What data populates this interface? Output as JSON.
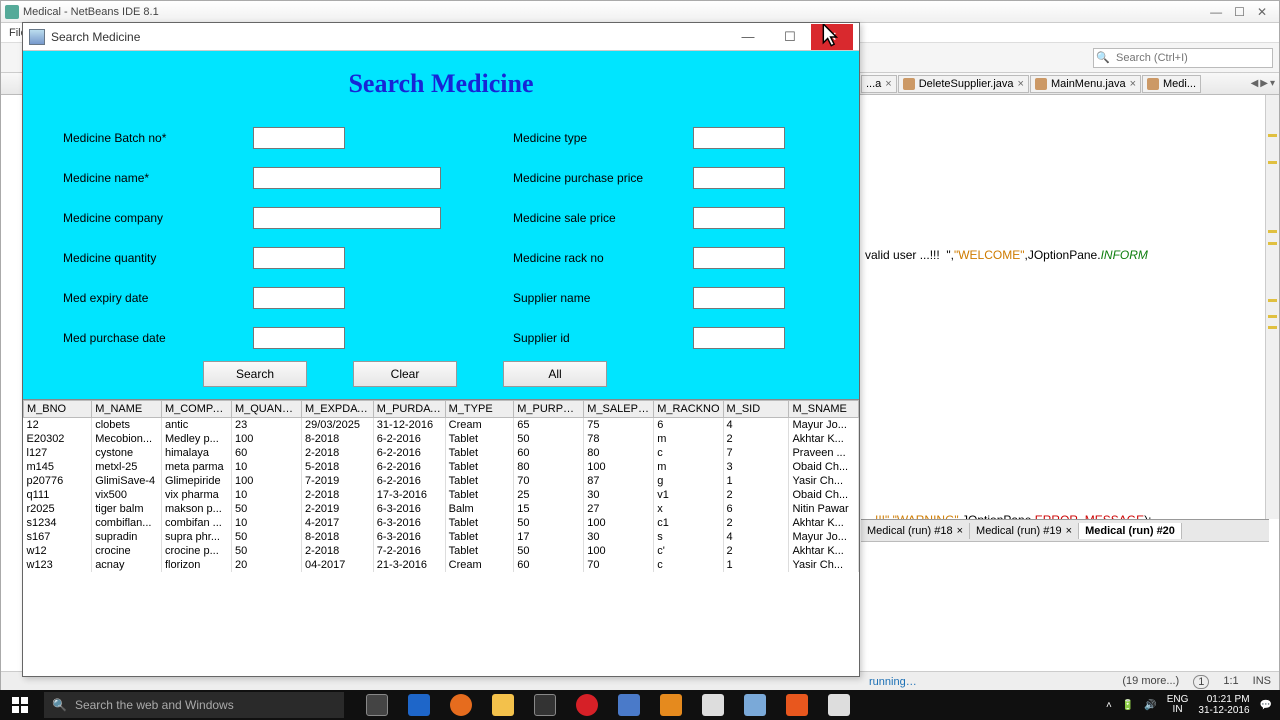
{
  "ide": {
    "title": "Medical - NetBeans IDE 8.1",
    "menu_file": "File",
    "search_placeholder": "Search (Ctrl+I)",
    "tabs": [
      {
        "label": "...a"
      },
      {
        "label": "DeleteSupplier.java"
      },
      {
        "label": "MainMenu.java"
      },
      {
        "label": "Medi..."
      }
    ],
    "code_line1_a": "valid user ...!!!  \",",
    "code_line1_b": "\"WELCOME\"",
    "code_line1_c": ",JOptionPane.",
    "code_line1_d": "INFORM",
    "code_line2_a": "...!!!\",",
    "code_line2_b": "\"WARNING\"",
    "code_line2_c": ",JOptionPane.",
    "code_line2_d": "ERROR_MESSAGE",
    "code_line2_e": ");",
    "out_tabs": [
      {
        "label": "Medical (run) #18"
      },
      {
        "label": "Medical (run) #19"
      },
      {
        "label": "Medical (run) #20"
      }
    ],
    "status_running": "running…",
    "status_more": "(19 more...)",
    "status_badge": "1",
    "status_pos": "1:1",
    "status_ins": "INS"
  },
  "child": {
    "title": "Search Medicine",
    "heading": "Search Medicine",
    "labels": {
      "batch": "Medicine Batch no*",
      "name": "Medicine name*",
      "company": "Medicine company",
      "qty": "Medicine quantity",
      "exp": "Med expiry date",
      "pur": "Med purchase date",
      "type": "Medicine type",
      "pprice": "Medicine purchase price",
      "sprice": "Medicine sale price",
      "rack": "Medicine rack no",
      "sname": "Supplier name",
      "sid": "Supplier id"
    },
    "buttons": {
      "search": "Search",
      "clear": "Clear",
      "all": "All"
    },
    "columns": [
      "M_BNO",
      "M_NAME",
      "M_COMPA...",
      "M_QUANTI...",
      "M_EXPDATE",
      "M_PURDATE",
      "M_TYPE",
      "M_PURPRI...",
      "M_SALEPR...",
      "M_RACKNO",
      "M_SID",
      "M_SNAME"
    ],
    "rows": [
      [
        "12",
        "clobets",
        "antic",
        "23",
        "29/03/2025",
        "31-12-2016",
        "Cream",
        "65",
        "75",
        "6",
        "4",
        "Mayur Jo..."
      ],
      [
        "E20302",
        "Mecobion...",
        "Medley p...",
        "100",
        "8-2018",
        "6-2-2016",
        "Tablet",
        "50",
        "78",
        "m",
        "2",
        "Akhtar K..."
      ],
      [
        "l127",
        "cystone",
        "himalaya",
        "60",
        "2-2018",
        "6-2-2016",
        "Tablet",
        "60",
        "80",
        "c",
        "7",
        "Praveen ..."
      ],
      [
        "m145",
        "metxl-25",
        "meta parma",
        "10",
        "5-2018",
        "6-2-2016",
        "Tablet",
        "80",
        "100",
        "m",
        "3",
        "Obaid Ch..."
      ],
      [
        "p20776",
        "GlimiSave-4",
        "Glimepiride",
        "100",
        "7-2019",
        "6-2-2016",
        "Tablet",
        "70",
        "87",
        "g",
        "1",
        "Yasir Ch..."
      ],
      [
        "q111",
        "vix500",
        "vix  pharma",
        "10",
        "2-2018",
        "17-3-2016",
        "Tablet",
        "25",
        "30",
        "v1",
        "2",
        "Obaid Ch..."
      ],
      [
        "r2025",
        "tiger balm",
        "makson p...",
        "50",
        "2-2019",
        "6-3-2016",
        "Balm",
        "15",
        "27",
        "x",
        "6",
        "Nitin Pawar"
      ],
      [
        "s1234",
        "combiflan...",
        "combifan ...",
        "10",
        "4-2017",
        "6-3-2016",
        "Tablet",
        "50",
        "100",
        "c1",
        "2",
        "Akhtar K..."
      ],
      [
        "s167",
        "supradin",
        "supra phr...",
        "50",
        "8-2018",
        "6-3-2016",
        "Tablet",
        "17",
        "30",
        "s",
        "4",
        "Mayur Jo..."
      ],
      [
        "w12",
        "crocine",
        "crocine p...",
        "50",
        "2-2018",
        "7-2-2016",
        "Tablet",
        "50",
        "100",
        "c'",
        "2",
        "Akhtar K..."
      ],
      [
        "w123",
        "acnay",
        "florizon",
        "20",
        "04-2017",
        "21-3-2016",
        "Cream",
        "60",
        "70",
        "c",
        "1",
        "Yasir Ch..."
      ]
    ]
  },
  "taskbar": {
    "search_placeholder": "Search the web and Windows",
    "time": "01:21 PM",
    "date": "31-12-2016",
    "lang": "ENG\nIN"
  }
}
